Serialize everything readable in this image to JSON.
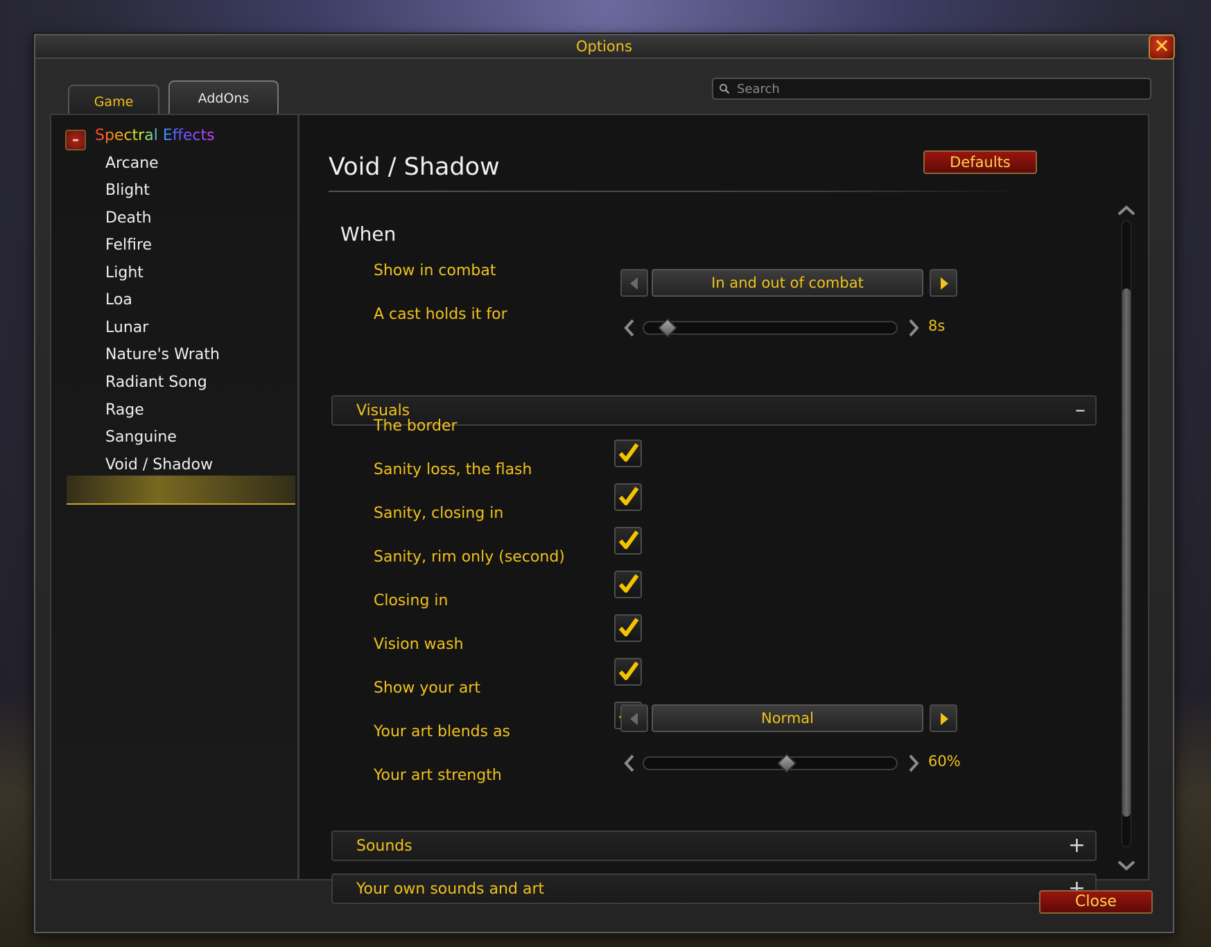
{
  "window": {
    "title": "Options"
  },
  "tabs": [
    {
      "label": "Game"
    },
    {
      "label": "AddOns"
    }
  ],
  "search": {
    "placeholder": "Search"
  },
  "sidebar": {
    "addon_name": "Spectral Effects",
    "collapse_symbol": "–",
    "items": [
      {
        "label": "Arcane"
      },
      {
        "label": "Blight"
      },
      {
        "label": "Death"
      },
      {
        "label": "Felfire"
      },
      {
        "label": "Light"
      },
      {
        "label": "Loa"
      },
      {
        "label": "Lunar"
      },
      {
        "label": "Nature's Wrath"
      },
      {
        "label": "Radiant Song"
      },
      {
        "label": "Rage"
      },
      {
        "label": "Sanguine"
      },
      {
        "label": "Void / Shadow"
      }
    ],
    "selected": "Void / Shadow"
  },
  "content": {
    "title": "Void / Shadow",
    "defaults_label": "Defaults",
    "when": {
      "heading": "When",
      "show_in_combat": {
        "label": "Show in combat",
        "value": "In and out of combat"
      },
      "cast_holds": {
        "label": "A cast holds it for",
        "value_text": "8s",
        "fraction": 0.07
      }
    },
    "visuals": {
      "heading": "Visuals",
      "toggle": "–",
      "checks": [
        {
          "label": "The border",
          "checked": true
        },
        {
          "label": "Sanity loss, the flash",
          "checked": true
        },
        {
          "label": "Sanity, closing in",
          "checked": true
        },
        {
          "label": "Sanity, rim only (second)",
          "checked": true
        },
        {
          "label": "Closing in",
          "checked": true
        },
        {
          "label": "Vision wash",
          "checked": true
        },
        {
          "label": "Show your art",
          "checked": true
        }
      ],
      "blend": {
        "label": "Your art blends as",
        "value": "Normal"
      },
      "strength": {
        "label": "Your art strength",
        "value_text": "60%",
        "fraction": 0.57
      }
    },
    "sounds": {
      "heading": "Sounds",
      "toggle": "+"
    },
    "own": {
      "heading": "Your own sounds and art",
      "toggle": "+"
    }
  },
  "footer": {
    "close_label": "Close"
  },
  "colors": {
    "gold": "#f2c21a",
    "red_button": "#9b1410",
    "text_white": "#f0f0f0"
  }
}
